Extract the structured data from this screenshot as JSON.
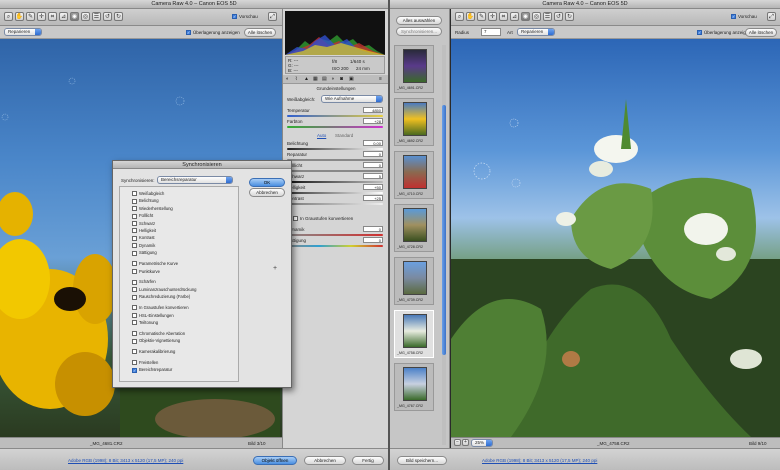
{
  "left_window": {
    "title": "Camera Raw 4.0 – Canon EOS 5D",
    "preview_label": "Vorschau",
    "overlay_label": "Überlagerung anzeigen",
    "clear_all_label": "Alle löschen",
    "repair_select": "Reparieren",
    "file_name": "_MG_4681.CR2",
    "image_count": "Bild 3/10",
    "workflow_link": "Adobe RGB (1998); 8 Bit; 3413 x 5120 (17,5 MP); 240 ppi",
    "open_button": "Objekt öffnen",
    "cancel_button": "Abbrechen",
    "done_button": "Fertig"
  },
  "info": {
    "r_label": "R:",
    "g_label": "G:",
    "b_label": "B:",
    "r": "---",
    "g": "---",
    "b": "---",
    "aperture": "f/8",
    "shutter": "1/640 s",
    "iso": "ISO 200",
    "focal": "24 mm"
  },
  "basic_panel": {
    "title": "Grundeinstellungen",
    "wb_label": "Weißabgleich:",
    "wb_value": "Wie Aufnahme",
    "temp_label": "Temperatur",
    "temp_value": "4850",
    "tint_label": "Farbton",
    "tint_value": "+28",
    "auto_label": "Auto",
    "default_label": "Standard",
    "exposure_label": "Belichtung",
    "exposure_value": "0,00",
    "recovery_label": "Reparatur",
    "recovery_value": "0",
    "filllight_label": "Fülllicht",
    "filllight_value": "0",
    "blacks_label": "Schwarz",
    "blacks_value": "5",
    "brightness_label": "Helligkeit",
    "brightness_value": "+50",
    "contrast_label": "Kontrast",
    "contrast_value": "+25",
    "grayscale_label": "In Graustufen konvertieren",
    "dynamics_label": "Dynamik",
    "dynamics_value": "0",
    "saturation_label": "Sättigung",
    "saturation_value": "0"
  },
  "dialog": {
    "title": "Synchronisieren",
    "sync_label": "Synchronisieren:",
    "sync_value": "Bereichsreparatur",
    "ok": "OK",
    "cancel": "Abbrechen",
    "items": [
      {
        "label": "Weißabgleich",
        "checked": false
      },
      {
        "label": "Belichtung",
        "checked": false
      },
      {
        "label": "Wiederherstellung",
        "checked": false
      },
      {
        "label": "Fülllicht",
        "checked": false
      },
      {
        "label": "Schwarz",
        "checked": false
      },
      {
        "label": "Helligkeit",
        "checked": false
      },
      {
        "label": "Kontrast",
        "checked": false
      },
      {
        "label": "Dynamik",
        "checked": false
      },
      {
        "label": "Sättigung",
        "checked": false
      },
      {
        "label": "Parametrische Kurve",
        "checked": false
      },
      {
        "label": "Punktkurve",
        "checked": false
      },
      {
        "label": "Schärfen",
        "checked": false
      },
      {
        "label": "Luminanzrauschunterdrückung",
        "checked": false
      },
      {
        "label": "Rauschreduzierung (Farbe)",
        "checked": false
      },
      {
        "label": "In Graustufen konvertieren",
        "checked": false
      },
      {
        "label": "HSL-Einstellungen",
        "checked": false
      },
      {
        "label": "Teiltonung",
        "checked": false
      },
      {
        "label": "Chromatische Aberration",
        "checked": false
      },
      {
        "label": "Objektiv-Vignettierung",
        "checked": false
      },
      {
        "label": "Kamerakalibrierung",
        "checked": false
      },
      {
        "label": "Freistellen",
        "checked": false
      },
      {
        "label": "Bereichsreparatur",
        "checked": true
      }
    ]
  },
  "right_window": {
    "title": "Camera Raw 4.0 – Canon EOS 5D",
    "select_all": "Alles auswählen",
    "sync_button": "Synchronisieren...",
    "radius_label": "Radius",
    "radius_value": "7",
    "type_label": "Art",
    "type_value": "Reparieren",
    "overlay_label": "Überlagerung anzeigen",
    "clear_all_label": "Alle löschen",
    "preview_label": "Vorschau",
    "zoom_value": "25%",
    "file_name": "_MG_4758.CR2",
    "image_count": "Bild 9/10",
    "workflow_link": "Adobe RGB (1998); 8 Bit; 3413 x 5120 (17,5 MP); 240 ppi",
    "save_button": "Bild speichern...",
    "thumbs": [
      "_MG_4691.CR2",
      "_MG_4692.CR2",
      "_MG_4710.CR2",
      "_MG_4728.CR2",
      "_MG_4739.CR2",
      "_MG_4758.CR2",
      "_MG_4767.CR2"
    ]
  }
}
